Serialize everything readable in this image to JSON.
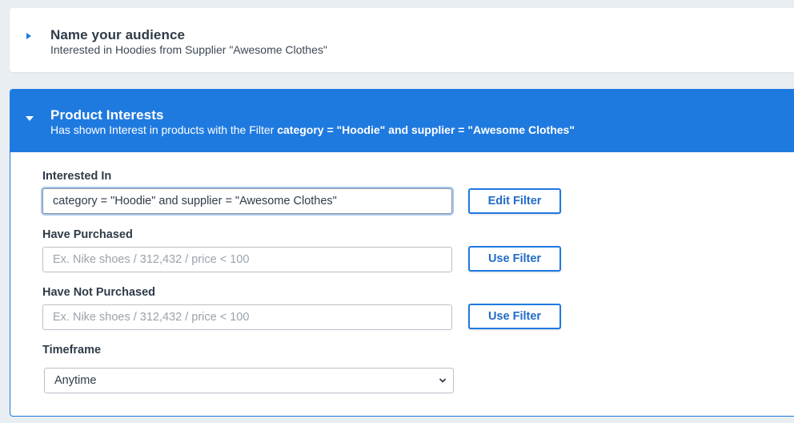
{
  "audience_name": {
    "title": "Name your audience",
    "subtitle": "Interested in Hoodies from Supplier \"Awesome Clothes\""
  },
  "product_interests": {
    "title": "Product Interests",
    "subtitle_prefix": "Has shown Interest in products with the Filter ",
    "subtitle_filter": "category = \"Hoodie\" and supplier = \"Awesome Clothes\"",
    "interested_in": {
      "label": "Interested In",
      "value": "category = \"Hoodie\" and supplier = \"Awesome Clothes\"",
      "button": "Edit Filter"
    },
    "have_purchased": {
      "label": "Have Purchased",
      "placeholder": "Ex. Nike shoes / 312,432 / price < 100",
      "button": "Use Filter"
    },
    "have_not_purchased": {
      "label": "Have Not Purchased",
      "placeholder": "Ex. Nike shoes / 312,432 / price < 100",
      "button": "Use Filter"
    },
    "timeframe": {
      "label": "Timeframe",
      "selected": "Anytime"
    }
  },
  "colors": {
    "accent": "#1f7ae0",
    "background": "#e9eef3",
    "text": "#2f3b48"
  }
}
